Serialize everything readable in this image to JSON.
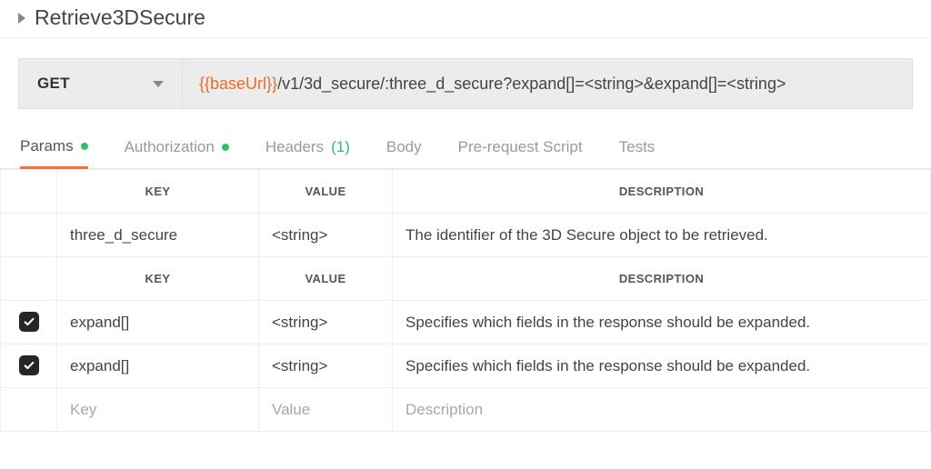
{
  "request": {
    "title": "Retrieve3DSecure",
    "method": "GET",
    "url_variable": "{{baseUrl}}",
    "url_path": "/v1/3d_secure/:three_d_secure?expand[]=<string>&expand[]=<string>"
  },
  "tabs": {
    "params": "Params",
    "authorization": "Authorization",
    "headers": "Headers",
    "headers_count": "(1)",
    "body": "Body",
    "prerequest": "Pre-request Script",
    "tests": "Tests"
  },
  "table_headers": {
    "key": "KEY",
    "value": "VALUE",
    "description": "DESCRIPTION"
  },
  "path_params": [
    {
      "key": "three_d_secure",
      "value": "<string>",
      "description": "The identifier of the 3D Secure object to be retrieved."
    }
  ],
  "query_params": [
    {
      "checked": true,
      "key": "expand[]",
      "value": "<string>",
      "description": "Specifies which fields in the response should be expanded."
    },
    {
      "checked": true,
      "key": "expand[]",
      "value": "<string>",
      "description": "Specifies which fields in the response should be expanded."
    }
  ],
  "blank_row": {
    "key_placeholder": "Key",
    "value_placeholder": "Value",
    "description_placeholder": "Description"
  }
}
